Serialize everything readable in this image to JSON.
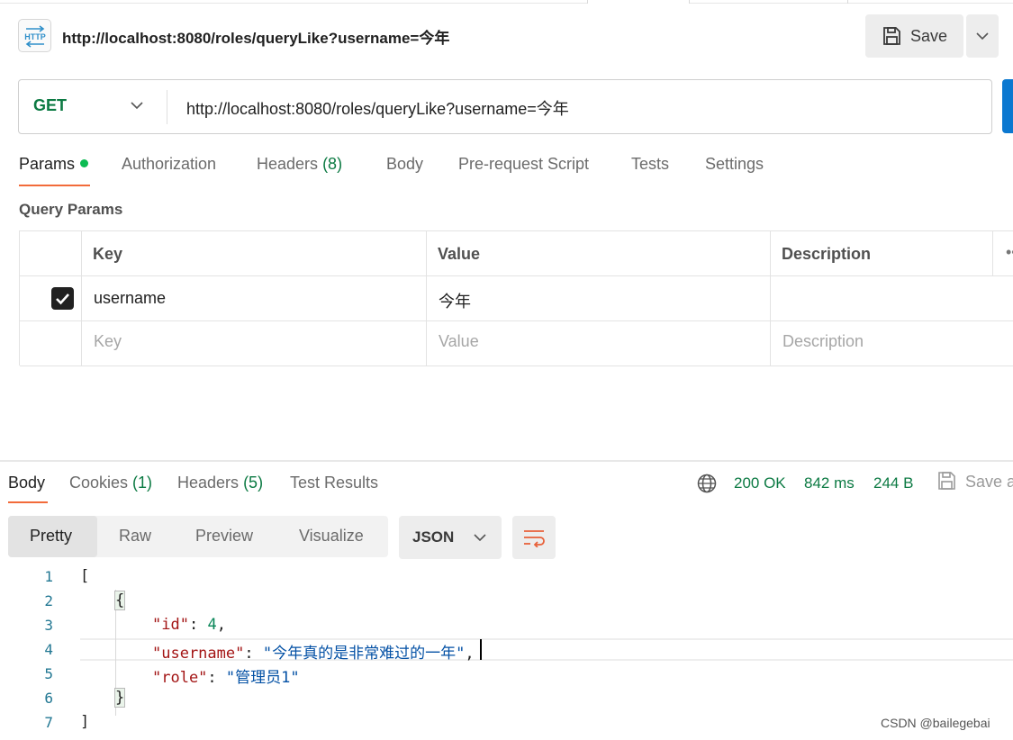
{
  "request": {
    "title": "http://localhost:8080/roles/queryLike?username=今年",
    "save_label": "Save",
    "method": "GET",
    "url": "http://localhost:8080/roles/queryLike?username=今年"
  },
  "request_tabs": [
    {
      "label": "Params",
      "count": ""
    },
    {
      "label": "Authorization",
      "count": ""
    },
    {
      "label": "Headers",
      "count": "(8)"
    },
    {
      "label": "Body",
      "count": ""
    },
    {
      "label": "Pre-request Script",
      "count": ""
    },
    {
      "label": "Tests",
      "count": ""
    },
    {
      "label": "Settings",
      "count": ""
    }
  ],
  "query_params": {
    "label": "Query Params",
    "columns": [
      "Key",
      "Value",
      "Description"
    ],
    "rows": [
      {
        "checked": true,
        "key": "username",
        "value": "今年",
        "description": ""
      }
    ],
    "placeholder": {
      "key": "Key",
      "value": "Value",
      "description": "Description"
    }
  },
  "response_tabs": [
    {
      "label": "Body",
      "count": ""
    },
    {
      "label": "Cookies",
      "count": "(1)"
    },
    {
      "label": "Headers",
      "count": "(5)"
    },
    {
      "label": "Test Results",
      "count": ""
    }
  ],
  "response_status": {
    "status": "200 OK",
    "time": "842 ms",
    "size": "244 B",
    "save_label": "Save a"
  },
  "view_modes": [
    "Pretty",
    "Raw",
    "Preview",
    "Visualize"
  ],
  "format": "JSON",
  "code": {
    "line_numbers": [
      "1",
      "2",
      "3",
      "4",
      "5",
      "6",
      "7"
    ],
    "open_array": "[",
    "open_obj": "{",
    "close_obj": "}",
    "close_array": "]",
    "fields": [
      {
        "key": "\"id\"",
        "sep": ": ",
        "value": "4",
        "end": ","
      },
      {
        "key": "\"username\"",
        "sep": ": ",
        "value": "\"今年真的是非常难过的一年\"",
        "end": ","
      },
      {
        "key": "\"role\"",
        "sep": ": ",
        "value": "\"管理员1\"",
        "end": ""
      }
    ]
  },
  "watermark": "CSDN @bailegebai",
  "colors": {
    "accent": "#f26b3a",
    "success": "#0c7a43",
    "send": "#0b78d0"
  }
}
